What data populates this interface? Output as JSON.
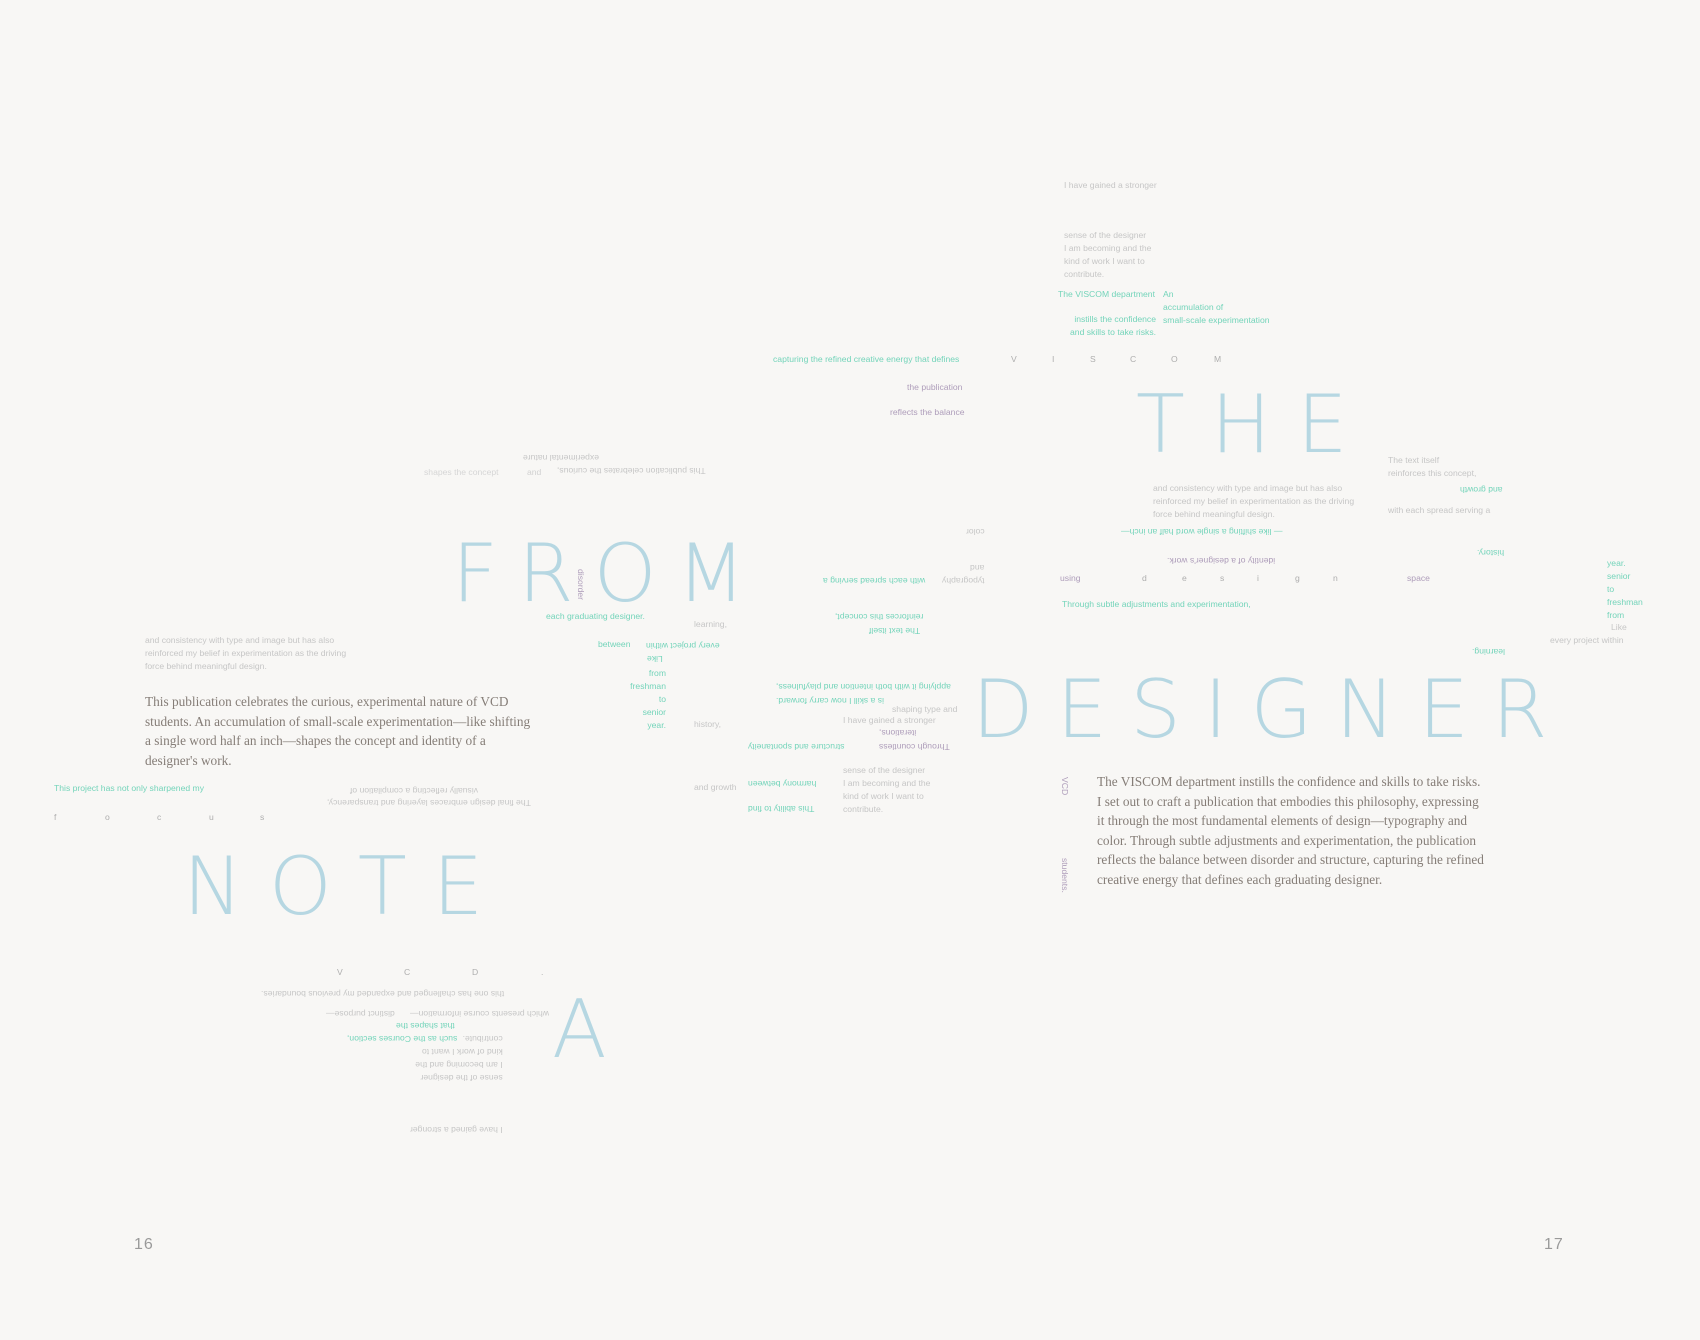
{
  "titles": {
    "the": "THE",
    "from": "FROM",
    "designer": "DESIGNER",
    "note": "NOTE",
    "a": "A"
  },
  "page_numbers": {
    "left": "16",
    "right": "17"
  },
  "body": {
    "left": "This publication celebrates the curious, experimental nature of VCD\nstudents. An accumulation of small-scale experimentation—like shifting\na single word half an inch—shapes the concept and identity of a\ndesigner's work.",
    "right": "The VISCOM department instills the confidence and skills to take risks.\nI set out to craft a publication that embodies this philosophy, expressing\nit through the most fundamental elements of design—typography and\ncolor. Through subtle adjustments and experimentation, the publication\nreflects the balance between disorder and structure, capturing the refined\ncreative energy that defines each graduating designer."
  },
  "spaced_words": {
    "viscom": [
      "V",
      "I",
      "S",
      "C",
      "O",
      "M"
    ],
    "design": [
      "d",
      "e",
      "s",
      "i",
      "g",
      "n"
    ],
    "focus": [
      "f",
      "o",
      "c",
      "u",
      "s"
    ],
    "vcd": [
      "V",
      "C",
      "D",
      "."
    ]
  },
  "fragments": {
    "gained_top": "I have gained a stronger",
    "sense_top": "sense of the designer\nI am becoming and the\nkind of work I want to\ncontribute.",
    "viscom_dept": "The VISCOM department",
    "instills": "instills the confidence\nand skills to take risks.",
    "accumulation": "An\naccumulation of\nsmall-scale experimentation",
    "capturing": "capturing the refined creative energy that defines",
    "the_publication": "the publication",
    "reflects_balance": "reflects the balance",
    "text_itself_r": "The text itself\nreinforces this concept,",
    "and_growth_r": "and growth",
    "with_each_r": "with each spread serving a",
    "consistency_r": "and consistency with type and image but has also\nreinforced my belief in experimentation as the driving\nforce behind meaningful design.",
    "shifting_flip": "— like shifting a single word half an inch—",
    "identity_flip": "identity of a designer's work.",
    "history_flip": "history.",
    "color_flip": "color",
    "using": "using",
    "space": "space",
    "through_subtle": "Through subtle adjustments and experimentation,",
    "learning_flip": "learning.",
    "every_project_r": "every project within",
    "like_r": "Like",
    "freshman_r_stack": "year.\nsenior\nto\nfreshman\nfrom",
    "experimental_flip": "experimental nature",
    "pub_celebrates_flip": "This publication celebrates the curious,",
    "and_word": "and",
    "shapes_concept_flip": "shapes the concept",
    "disorder": "disorder",
    "with_each_flip": "with each spread serving a",
    "typography_flip": "typography",
    "and_flip": "and",
    "each_graduating": "each graduating designer.",
    "learning_c": "learning,",
    "reinforces_flip": "reinforces this concept,",
    "text_itself_flip": "The text itself",
    "between": "between",
    "every_project_flip": "every project within",
    "like_c": "Like",
    "freshman_stack": "from\nfreshman\nto\nsenior\nyear.",
    "history_c": "history,",
    "and_growth_c": "and growth",
    "applying_flip": "applying it with both intention and playfulness,",
    "skill_flip": "is a skill I now carry forward.",
    "shaping": "shaping type and",
    "gained_mid": "I have gained a stronger",
    "iterations_flip": "iterations,",
    "through_countless_flip": "Through countless",
    "structure_flip": "structure and spontaneity",
    "harmony_flip": "harmony between",
    "ability_flip": "This ability to find",
    "sense_mid": "sense of the designer\nI am becoming and the\nkind of work I want to\ncontribute.",
    "consistency_l": "and consistency with type and image but has also\nreinforced my belief in experimentation as the driving\nforce behind meaningful design.",
    "project_sharpened": "This project has not only sharpened my",
    "visually_flip": "visually reflecting a compilation of",
    "final_design_flip": "The final design embraces layering and transparency,",
    "vcd_vert": "VCD",
    "students_vert": "students.",
    "this_one_flip": "this one has challenged and expanded my previous boundaries.",
    "distinct_flip": "distinct purpose—",
    "which_presents_flip": "which presents course information—",
    "such_as_flip": "such as the Courses section,",
    "that_shapes_flip": "that shapes the",
    "sense_flip_stack": "I have gained a stronger\n\n\n\nsense of the designer\nI am becoming and the\nkind of work I want to\ncontribute."
  }
}
